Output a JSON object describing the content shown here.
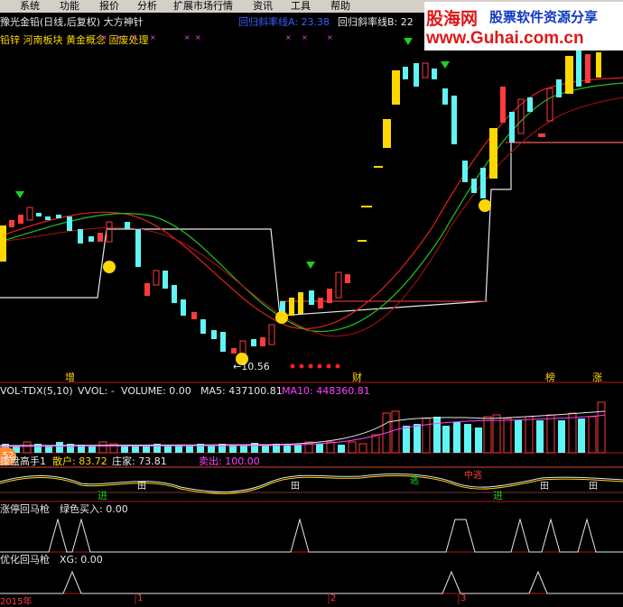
{
  "menu": [
    "系统",
    "功能",
    "报价",
    "分析",
    "扩展市场行情",
    "资讯",
    "工具",
    "帮助"
  ],
  "watermark": {
    "site": "股海网",
    "slogan": "股票软件资源分享",
    "url": "www.Guhai.com.cn"
  },
  "main_panel": {
    "title": "豫光金铅(日线,后复权) 大方神针",
    "line_a": "回归斜率线A: 23.38",
    "line_b": "回归斜率线B: 22",
    "tags": "铅锌 河南板块 黄金概念 固废处理",
    "low_price": "10.56",
    "marker_zeng": "增",
    "marker_cai": "财",
    "marker_bang": "榜",
    "marker_zhang": "涨"
  },
  "vol_panel": {
    "title": "VOL-TDX(5,10)",
    "vvol": "VVOL: -",
    "volume": "VOLUME: 0.00",
    "ma5": "MA5: 437100.81",
    "ma10": "MA10: 448360.81"
  },
  "trader_panel": {
    "badge": "52",
    "title": "操盘高手1",
    "sanhu": "散户: 83.72",
    "zhuangjia": "庄家: 73.81",
    "maichu": "卖出: 100.00",
    "jin": "进",
    "jin2": "进",
    "zhong": "中逃",
    "tao": "逃",
    "tian": "田"
  },
  "limitup_panel": {
    "title": "涨停回马枪",
    "label": "绿色买入: 0.00"
  },
  "opt_panel": {
    "title": "优化回马枪",
    "label": "XG: 0.00"
  },
  "date_axis": {
    "year": "2015年",
    "m1": "1",
    "m2": "2",
    "m3": "3"
  },
  "colors": {
    "up": "#ff3a3a",
    "down": "#5ff5f5",
    "bg": "#000000",
    "yellow": "#ffd700",
    "magenta": "#ff40ff"
  }
}
